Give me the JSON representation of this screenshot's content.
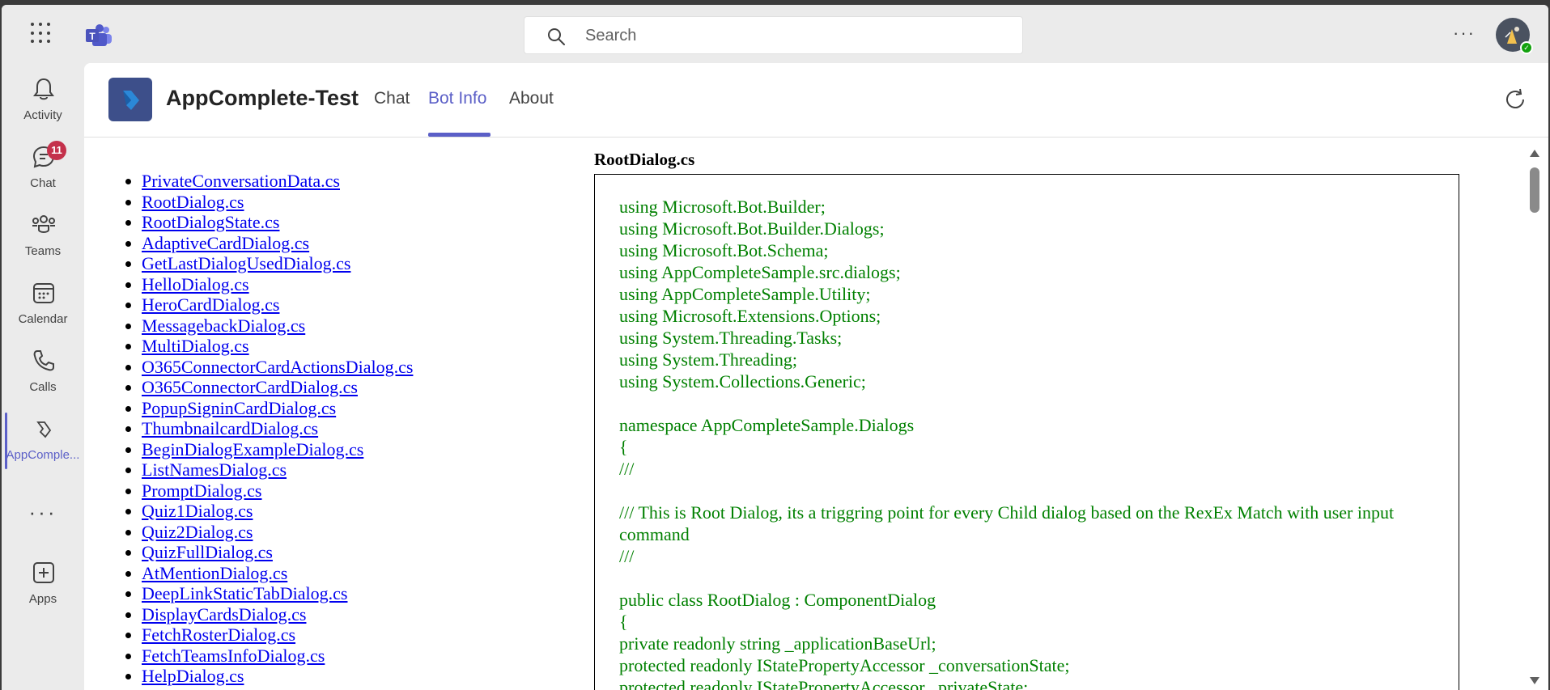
{
  "topbar": {
    "search_placeholder": "Search",
    "more_label": "···"
  },
  "rail": {
    "items": [
      {
        "label": "Activity",
        "icon": "bell-icon"
      },
      {
        "label": "Chat",
        "icon": "chat-icon",
        "badge": "11"
      },
      {
        "label": "Teams",
        "icon": "teams-icon"
      },
      {
        "label": "Calendar",
        "icon": "calendar-icon"
      },
      {
        "label": "Calls",
        "icon": "phone-icon"
      },
      {
        "label": "AppComple...",
        "icon": "app-icon"
      },
      {
        "label": "Apps",
        "icon": "add-app-icon"
      }
    ],
    "more_label": "···"
  },
  "app": {
    "title": "AppComplete-Test",
    "tabs": [
      "Chat",
      "Bot Info",
      "About"
    ],
    "active_tab": "Bot Info",
    "accent_color": "#5b5fc7"
  },
  "files": [
    "PrivateConversationData.cs",
    "RootDialog.cs",
    "RootDialogState.cs",
    "AdaptiveCardDialog.cs",
    "GetLastDialogUsedDialog.cs",
    "HelloDialog.cs",
    "HeroCardDialog.cs",
    "MessagebackDialog.cs",
    "MultiDialog.cs",
    "O365ConnectorCardActionsDialog.cs",
    "O365ConnectorCardDialog.cs",
    "PopupSigninCardDialog.cs",
    "ThumbnailcardDialog.cs",
    "BeginDialogExampleDialog.cs",
    "ListNamesDialog.cs",
    "PromptDialog.cs",
    "Quiz1Dialog.cs",
    "Quiz2Dialog.cs",
    "QuizFullDialog.cs",
    "AtMentionDialog.cs",
    "DeepLinkStaticTabDialog.cs",
    "DisplayCardsDialog.cs",
    "FetchRosterDialog.cs",
    "FetchTeamsInfoDialog.cs",
    "HelpDialog.cs"
  ],
  "code": {
    "title": "RootDialog.cs",
    "lines": [
      {
        "text": "using Microsoft.Bot.Builder;",
        "color": "green"
      },
      {
        "text": "using Microsoft.Bot.Builder.Dialogs;",
        "color": "green"
      },
      {
        "text": "using Microsoft.Bot.Schema;",
        "color": "green"
      },
      {
        "text": "using AppCompleteSample.src.dialogs;",
        "color": "green"
      },
      {
        "text": "using AppCompleteSample.Utility;",
        "color": "green"
      },
      {
        "text": "using Microsoft.Extensions.Options;",
        "color": "green"
      },
      {
        "text": "using System.Threading.Tasks;",
        "color": "green"
      },
      {
        "text": "using System.Threading;",
        "color": "green"
      },
      {
        "text": "using System.Collections.Generic;",
        "color": "green"
      },
      {
        "text": "",
        "color": "green"
      },
      {
        "text": "namespace AppCompleteSample.Dialogs",
        "color": "green"
      },
      {
        "text": "{",
        "color": "green"
      },
      {
        "text": "///",
        "color": "green"
      },
      {
        "text": "",
        "color": "green"
      },
      {
        "text": "/// This is Root Dialog, its a triggring point for every Child dialog based on the RexEx Match with user input command",
        "color": "green"
      },
      {
        "text": "///",
        "color": "green"
      },
      {
        "text": "",
        "color": "green"
      },
      {
        "text": "public class RootDialog : ComponentDialog",
        "color": "green"
      },
      {
        "text": "{",
        "color": "green"
      },
      {
        "text": "private readonly string _applicationBaseUrl;",
        "color": "green"
      },
      {
        "text": "protected readonly IStatePropertyAccessor _conversationState;",
        "color": "green"
      },
      {
        "text": "protected readonly IStatePropertyAccessor _privateState;",
        "color": "green"
      }
    ]
  }
}
